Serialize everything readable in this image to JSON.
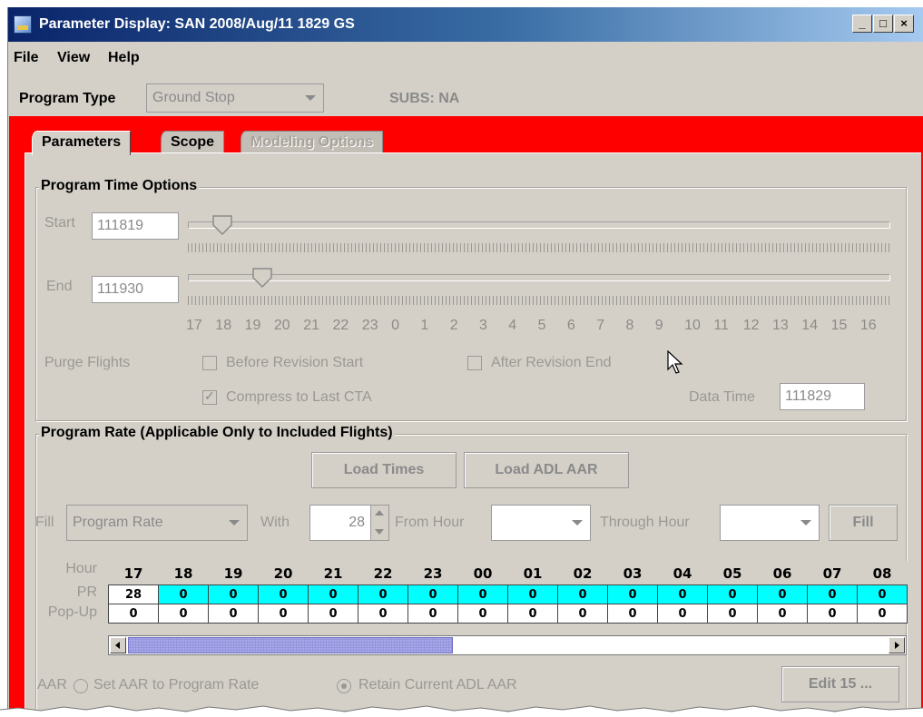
{
  "window": {
    "title": "Parameter Display: SAN 2008/Aug/11 1829 GS",
    "controls": [
      "minimize-icon",
      "maximize-icon",
      "close-icon"
    ]
  },
  "menu": {
    "file": "File",
    "view": "View",
    "help": "Help"
  },
  "program_type": {
    "label": "Program Type",
    "value": "Ground Stop",
    "subs": "SUBS: NA"
  },
  "tabs": [
    {
      "label": "Parameters",
      "state": "active"
    },
    {
      "label": "Scope",
      "state": "enabled"
    },
    {
      "label": "Modeling Options",
      "state": "disabled"
    }
  ],
  "time_options": {
    "title": "Program Time Options",
    "start_label": "Start",
    "start_value": "111819",
    "end_label": "End",
    "end_value": "111930",
    "hour_ticks": [
      "17",
      "18",
      "19",
      "20",
      "21",
      "22",
      "23",
      "0",
      "1",
      "2",
      "3",
      "4",
      "5",
      "6",
      "7",
      "8",
      "9",
      "10",
      "11",
      "12",
      "13",
      "14",
      "15",
      "16"
    ],
    "purge_label": "Purge Flights",
    "before_revision": {
      "label": "Before Revision Start",
      "checked": false
    },
    "after_revision": {
      "label": "After Revision End",
      "checked": false
    },
    "compress": {
      "label": "Compress to Last CTA",
      "checked": true
    },
    "data_time_label": "Data Time",
    "data_time_value": "111829"
  },
  "program_rate": {
    "title": "Program Rate (Applicable Only to Included Flights)",
    "load_times": "Load Times",
    "load_adl_aar": "Load ADL AAR",
    "fill_label": "Fill",
    "fill_value": "Program Rate",
    "with_label": "With",
    "with_value": "28",
    "from_hour_label": "From Hour",
    "from_hour_value": "",
    "through_hour_label": "Through Hour",
    "through_hour_value": "",
    "fill_button": "Fill",
    "row_labels": {
      "hour": "Hour",
      "pr": "PR",
      "popup": "Pop-Up"
    },
    "hours": [
      "17",
      "18",
      "19",
      "20",
      "21",
      "22",
      "23",
      "00",
      "01",
      "02",
      "03",
      "04",
      "05",
      "06",
      "07",
      "08"
    ],
    "pr": [
      "28",
      "0",
      "0",
      "0",
      "0",
      "0",
      "0",
      "0",
      "0",
      "0",
      "0",
      "0",
      "0",
      "0",
      "0",
      "0"
    ],
    "popup": [
      "0",
      "0",
      "0",
      "0",
      "0",
      "0",
      "0",
      "0",
      "0",
      "0",
      "0",
      "0",
      "0",
      "0",
      "0",
      "0"
    ],
    "colors": {
      "pr_highlight": "#00ffff",
      "frame": "#ff0000",
      "scroll_thumb": "#a6a6e8"
    }
  },
  "aar": {
    "label": "AAR",
    "option_set": {
      "label": "Set AAR to Program Rate",
      "selected": false
    },
    "option_retain": {
      "label": "Retain Current ADL AAR",
      "selected": true
    },
    "edit_button": "Edit 15 ..."
  }
}
